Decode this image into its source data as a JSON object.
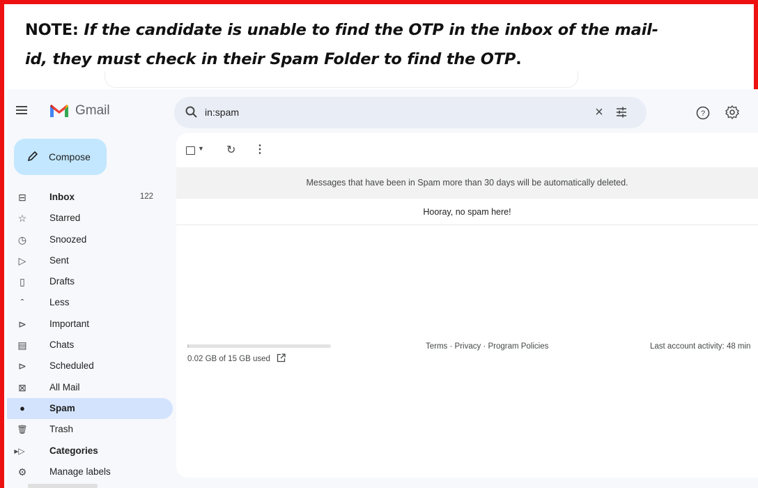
{
  "note": {
    "prefix": "NOTE:",
    "line1": "If the candidate is unable to find the OTP in the inbox of the mail-",
    "line2": "id, they must check in their Spam Folder to find the OTP",
    "end": "."
  },
  "header": {
    "brand": "Gmail",
    "search_value": "in:spam"
  },
  "compose": {
    "label": "Compose"
  },
  "nav": {
    "items": [
      {
        "label": "Inbox",
        "count": "122",
        "icon": "inbox-icon",
        "glyph": "⊟"
      },
      {
        "label": "Starred",
        "count": "",
        "icon": "star-icon",
        "glyph": "☆"
      },
      {
        "label": "Snoozed",
        "count": "",
        "icon": "clock-icon",
        "glyph": "◷"
      },
      {
        "label": "Sent",
        "count": "",
        "icon": "send-icon",
        "glyph": "▷"
      },
      {
        "label": "Drafts",
        "count": "",
        "icon": "draft-icon",
        "glyph": "▯"
      },
      {
        "label": "Less",
        "count": "",
        "icon": "chevron-up-icon",
        "glyph": "ˆ"
      },
      {
        "label": "Important",
        "count": "",
        "icon": "important-icon",
        "glyph": "⊳"
      },
      {
        "label": "Chats",
        "count": "",
        "icon": "chat-icon",
        "glyph": "▤"
      },
      {
        "label": "Scheduled",
        "count": "",
        "icon": "scheduled-icon",
        "glyph": "⊳"
      },
      {
        "label": "All Mail",
        "count": "",
        "icon": "all-mail-icon",
        "glyph": "⊠"
      },
      {
        "label": "Spam",
        "count": "",
        "icon": "spam-icon",
        "glyph": "●"
      },
      {
        "label": "Trash",
        "count": "",
        "icon": "trash-icon",
        "glyph": "🗑"
      },
      {
        "label": "Categories",
        "count": "",
        "icon": "label-icon",
        "glyph": "▸▷"
      },
      {
        "label": "Manage labels",
        "count": "",
        "icon": "gear-icon",
        "glyph": "⚙"
      }
    ]
  },
  "main": {
    "banner": "Messages that have been in Spam more than 30 days will be automatically deleted.",
    "empty_message": "Hooray, no spam here!",
    "storage_text": "0.02 GB of 15 GB used",
    "storage_used_fraction": 0.0013,
    "policies": "Terms · Privacy · Program Policies",
    "last_activity": "Last account activity: 48 min"
  },
  "colors": {
    "frame": "#ee1111",
    "compose_bg": "#c2e7ff",
    "active_nav": "#d3e3fd",
    "search_bg": "#e9eef6",
    "app_bg": "#f6f8fc"
  }
}
